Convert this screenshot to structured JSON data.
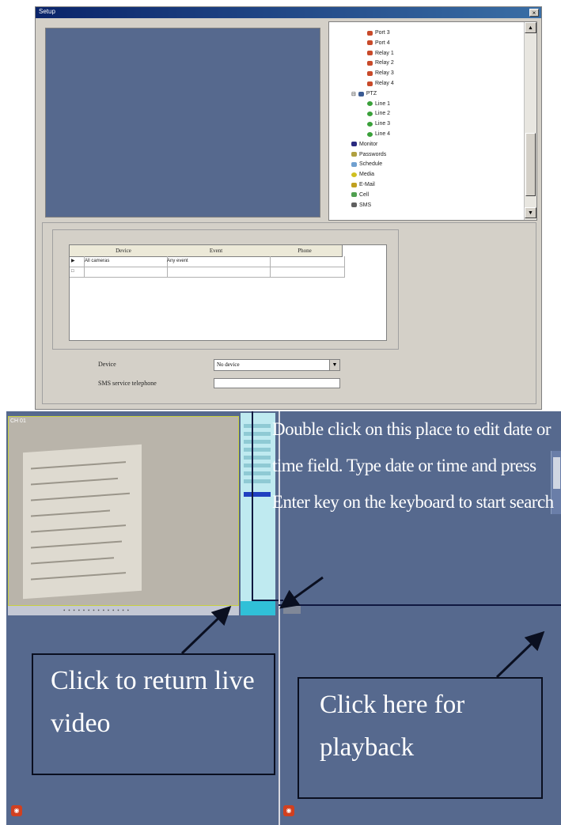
{
  "setup_window": {
    "title": "Setup",
    "close_glyph": "×",
    "tree": {
      "items": [
        {
          "label": "Port 3",
          "icon": "relay-icon",
          "kind": "relay",
          "indent": 2
        },
        {
          "label": "Port 4",
          "icon": "relay-icon",
          "kind": "relay",
          "indent": 2
        },
        {
          "label": "Relay 1",
          "icon": "relay-icon",
          "kind": "relay",
          "indent": 2
        },
        {
          "label": "Relay 2",
          "icon": "relay-icon",
          "kind": "relay",
          "indent": 2
        },
        {
          "label": "Relay 3",
          "icon": "relay-icon",
          "kind": "relay",
          "indent": 2
        },
        {
          "label": "Relay 4",
          "icon": "relay-icon",
          "kind": "relay",
          "indent": 2
        },
        {
          "label": "PTZ",
          "icon": "ptz-icon",
          "kind": "ptz",
          "indent": 1,
          "expander": "⊟"
        },
        {
          "label": "Line 1",
          "icon": "line-icon",
          "kind": "line",
          "indent": 2
        },
        {
          "label": "Line 2",
          "icon": "line-icon",
          "kind": "line",
          "indent": 2
        },
        {
          "label": "Line 3",
          "icon": "line-icon",
          "kind": "line",
          "indent": 2
        },
        {
          "label": "Line 4",
          "icon": "line-icon",
          "kind": "line",
          "indent": 2
        },
        {
          "label": "Monitor",
          "icon": "monitor-icon",
          "kind": "monitor",
          "indent": 1
        },
        {
          "label": "Passwords",
          "icon": "password-icon",
          "kind": "pass",
          "indent": 1
        },
        {
          "label": "Schedule",
          "icon": "schedule-icon",
          "kind": "sched",
          "indent": 1
        },
        {
          "label": "Media",
          "icon": "media-icon",
          "kind": "media",
          "indent": 1
        },
        {
          "label": "E-Mail",
          "icon": "email-icon",
          "kind": "email",
          "indent": 1
        },
        {
          "label": "Cell",
          "icon": "cell-icon",
          "kind": "cell",
          "indent": 1
        },
        {
          "label": "SMS",
          "icon": "sms-icon",
          "kind": "sms",
          "indent": 1
        }
      ],
      "scroll_up": "▲",
      "scroll_down": "▼"
    },
    "grid": {
      "columns": [
        "Device",
        "Event",
        "Phone"
      ],
      "rows": [
        {
          "marker": "▶",
          "device": "All cameras",
          "event": "Any event",
          "phone": ""
        },
        {
          "marker": "□",
          "device": "",
          "event": "",
          "phone": ""
        }
      ]
    },
    "form": {
      "device_label": "Device",
      "device_value": "No device",
      "device_arrow": "▼",
      "phone_label": "SMS service telephone",
      "phone_value": ""
    }
  },
  "dvr": {
    "camera_label": "CH 01",
    "timeline_dots": "• • • • • • • • • • • • • •",
    "instruction": "Double click on this place to edit date or time field. Type date or time and press Enter key on the keyboard to start search",
    "callout_live": "Click to return live video",
    "callout_playback": "Click here for playback",
    "rec_glyph": "◉",
    "colors": {
      "panel": "#56698e",
      "callout_border": "#0a0f20",
      "cyan": "#bfeaf0"
    }
  }
}
